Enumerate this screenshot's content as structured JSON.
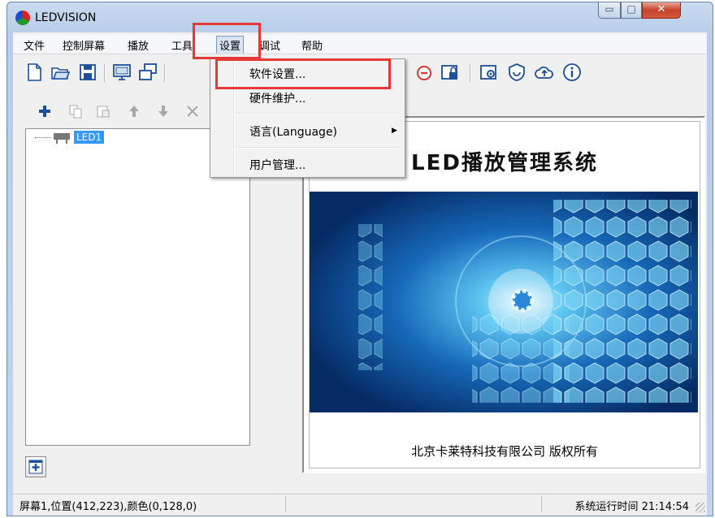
{
  "window": {
    "title": "LEDVISION"
  },
  "window_controls": {
    "minimize": "▭",
    "maximize": "□",
    "close": "✕"
  },
  "menubar": {
    "items": [
      "文件",
      "控制屏幕",
      "播放",
      "工具",
      "设置",
      "调试",
      "帮助"
    ],
    "active_index": 4
  },
  "settings_menu": {
    "items": [
      {
        "label": "软件设置...",
        "highlighted": true
      },
      {
        "label": "硬件维护..."
      },
      {
        "label": "语言(Language)",
        "submenu": true
      },
      {
        "label": "用户管理..."
      }
    ]
  },
  "toolbar": {
    "icons": [
      "new-file-icon",
      "open-folder-icon",
      "save-icon",
      "monitor-icon",
      "windows-icon",
      "stop-icon",
      "lock-icon",
      "settings-icon",
      "shield-icon",
      "cloud-icon",
      "info-icon"
    ]
  },
  "subtoolbar": {
    "icons": [
      "add-icon",
      "copy-icon",
      "paste-icon",
      "up-arrow-icon",
      "down-arrow-icon",
      "delete-icon"
    ]
  },
  "tree": {
    "items": [
      {
        "label": "LED1",
        "selected": true
      }
    ]
  },
  "splash": {
    "title": "LED播放管理系统",
    "footer": "北京卡莱特科技有限公司  版权所有"
  },
  "status": {
    "left": "屏幕1,位置(412,223),颜色(0,128,0)",
    "right": "系统运行时间 21:14:54"
  },
  "colors": {
    "highlight_box": "#e53935",
    "selection": "#3399ff"
  }
}
